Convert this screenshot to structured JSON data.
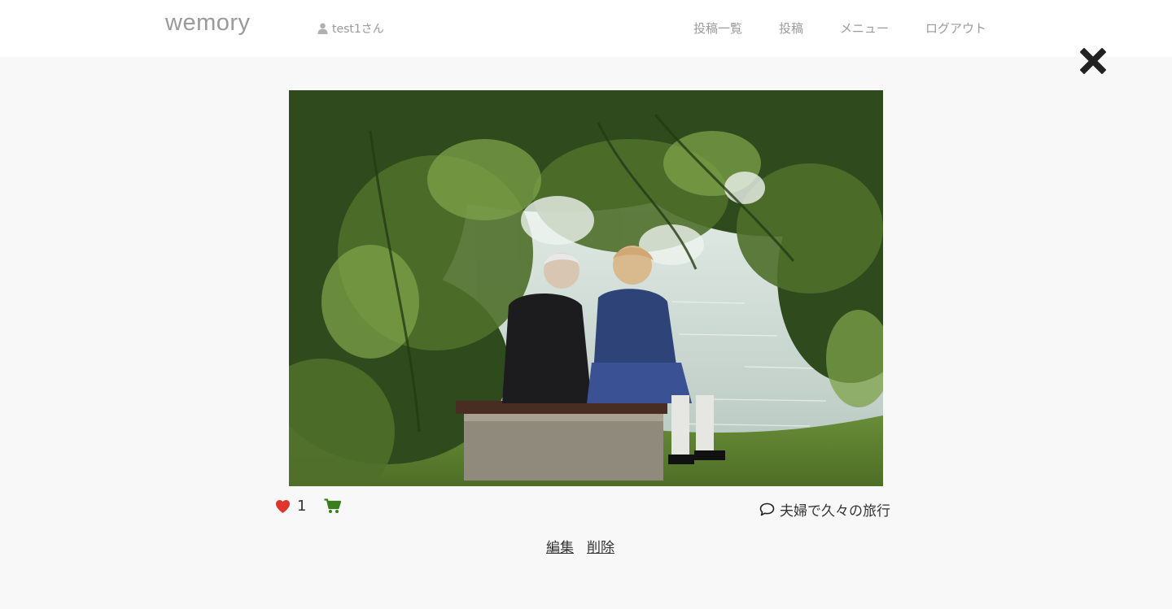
{
  "header": {
    "logo": "wemory",
    "user_label": "test1さん",
    "nav": [
      "投稿一覧",
      "投稿",
      "メニュー",
      "ログアウト"
    ]
  },
  "post": {
    "like_count": "1",
    "caption": "夫婦で久々の旅行",
    "edit_label": "編集",
    "delete_label": "削除"
  },
  "colors": {
    "heart": "#e0342a",
    "cart": "#3a7d1e",
    "nav_text": "#9a9a9a"
  },
  "icons": {
    "close": "close-icon",
    "user": "user-icon",
    "heart": "heart-icon",
    "cart": "cart-icon",
    "comment": "comment-icon"
  }
}
